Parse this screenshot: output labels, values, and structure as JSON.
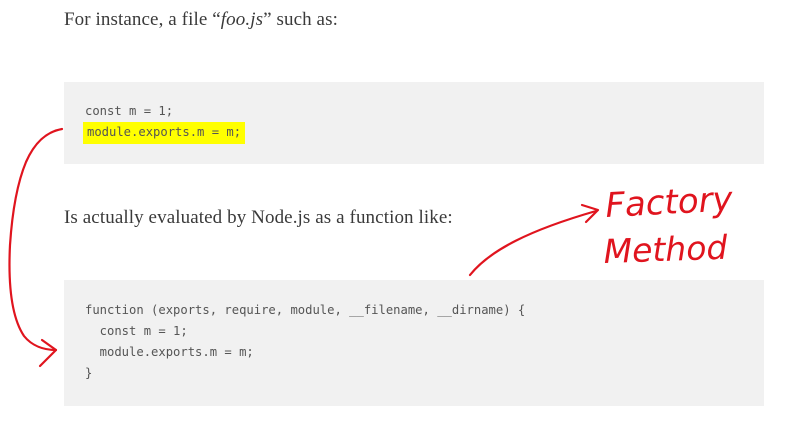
{
  "paragraphs": {
    "p1_prefix": "For instance, a file “",
    "p1_file": "foo.js",
    "p1_suffix": "” such as:",
    "p2": "Is actually evaluated by Node.js as a function like:"
  },
  "code_blocks": [
    {
      "lines": [
        "const m = 1;",
        "module.exports.m = m;"
      ],
      "highlighted_line": 1
    },
    {
      "lines": [
        "function (exports, require, module, __filename, __dirname) {",
        "  const m = 1;",
        "  module.exports.m = m;",
        "}"
      ]
    }
  ],
  "annotation": {
    "text_line1": "Factory",
    "text_line2": "Method",
    "ink_color": "#e0141e",
    "highlight_color": "#ffff00"
  }
}
